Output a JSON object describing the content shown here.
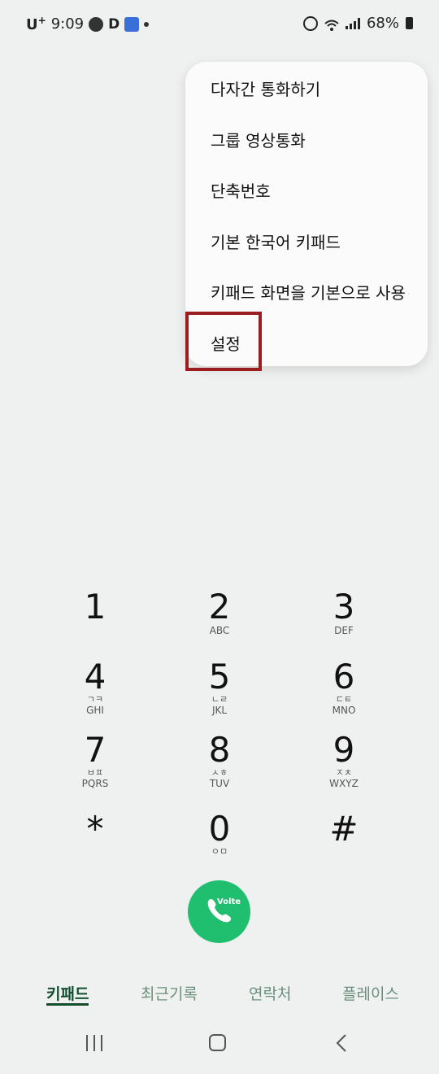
{
  "status_bar": {
    "carrier": "U",
    "carrier_sup": "+",
    "time": "9:09",
    "battery": "68%"
  },
  "menu": {
    "items": [
      "다자간 통화하기",
      "그룹 영상통화",
      "단축번호",
      "기본 한국어 키패드",
      "키패드 화면을 기본으로 사용",
      "설정"
    ]
  },
  "keypad": {
    "keys": [
      {
        "digit": "1",
        "sub": "",
        "letters": ""
      },
      {
        "digit": "2",
        "sub": "",
        "letters": "ABC"
      },
      {
        "digit": "3",
        "sub": "",
        "letters": "DEF"
      },
      {
        "digit": "4",
        "sub": "ㄱㅋ",
        "letters": "GHI"
      },
      {
        "digit": "5",
        "sub": "ㄴㄹ",
        "letters": "JKL"
      },
      {
        "digit": "6",
        "sub": "ㄷㅌ",
        "letters": "MNO"
      },
      {
        "digit": "7",
        "sub": "ㅂㅍ",
        "letters": "PQRS"
      },
      {
        "digit": "8",
        "sub": "ㅅㅎ",
        "letters": "TUV"
      },
      {
        "digit": "9",
        "sub": "ㅈㅊ",
        "letters": "WXYZ"
      },
      {
        "digit": "*",
        "sub": "",
        "letters": ""
      },
      {
        "digit": "0",
        "sub": "ㅇㅁ",
        "letters": ""
      },
      {
        "digit": "#",
        "sub": "",
        "letters": ""
      }
    ]
  },
  "call_button": {
    "badge": "Volte",
    "icon": "phone-icon"
  },
  "tabs": [
    "키패드",
    "최근기록",
    "연락처",
    "플레이스"
  ],
  "nav": {
    "recents_icon": "recents-icon",
    "home_icon": "home-icon",
    "back_icon": "back-icon"
  },
  "colors": {
    "background": "#eef1ef",
    "call_green": "#20bf6f",
    "tab_active": "#134d2e",
    "tab_inactive": "#6b8f7c",
    "highlight": "#9c1d1d"
  }
}
